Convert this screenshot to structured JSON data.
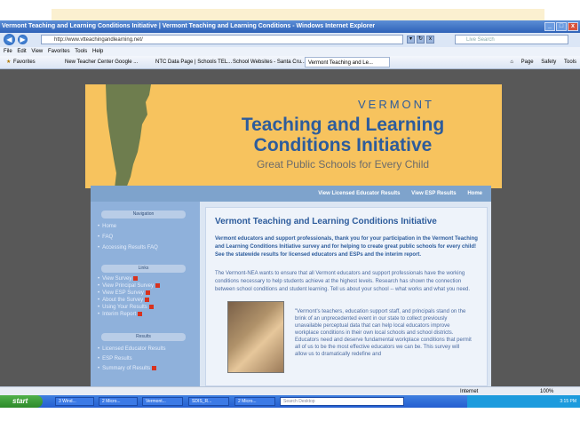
{
  "window": {
    "title": "Vermont Teaching and Learning Conditions Initiative | Vermont Teaching and Learning Conditions - Windows Internet Explorer"
  },
  "address_bar": {
    "url": "http://www.vtteachingandlearning.net/",
    "search_placeholder": "Live Search"
  },
  "menu": [
    "File",
    "Edit",
    "View",
    "Favorites",
    "Tools",
    "Help"
  ],
  "favorites": {
    "label": "Favorites",
    "items": [
      "New Teacher Center Google ...",
      "NTC Data Page | Schools TEL...",
      "School Websites - Santa Cru...",
      "Vermont Teaching and Le..."
    ],
    "commands": [
      "Page",
      "Safety",
      "Tools"
    ]
  },
  "banner": {
    "line1": "VERMONT",
    "line2": "Teaching and Learning",
    "line3": "Conditions Initiative",
    "line4": "Great Public Schools for Every Child",
    "colors": {
      "background": "#f7c35e",
      "title": "#2d5c9c",
      "map": "#6e7d4e"
    }
  },
  "site_nav": [
    "View Licensed Educator Results",
    "View ESP Results",
    "Home"
  ],
  "sidebar": {
    "navigation_heading": "Navigation",
    "navigation_items": [
      "Home",
      "FAQ",
      "Accessing Results FAQ"
    ],
    "links_heading": "Links",
    "link_items": [
      "View Survey",
      "View Principal Survey",
      "View ESP Survey",
      "About the Survey",
      "Using Your Results",
      "Interim Report"
    ],
    "results_heading": "Results",
    "result_items": [
      "Licensed Educator Results",
      "ESP Results",
      "Summary of Results"
    ]
  },
  "main": {
    "title": "Vermont Teaching and Learning Conditions Initiative",
    "intro": "Vermont educators and support professionals, thank you for your participation in the Vermont Teaching and Learning Conditions Initiative survey and for helping to create great public schools for every child! See the statewide results for licensed educators and ESPs and the interim report.",
    "paragraph": "The Vermont-NEA wants to ensure that all Vermont educators and support professionals have the working conditions necessary to help students achieve at the highest levels. Research has shown the connection between school conditions and student learning. Tell us about your school -- what works and what you need.",
    "quote": "\"Vermont's teachers, education support staff, and principals stand on the brink of an unprecedented event in our state to collect previously unavailable perceptual data that can help local educators improve workplace conditions in their own local schools and school districts. Educators need and deserve fundamental workplace conditions that permit all of us to be the most effective educators we can be. This survey will allow us to dramatically redefine and"
  },
  "status": {
    "zone": "Internet",
    "zoom": "100%"
  },
  "taskbar": {
    "start": "start",
    "items": [
      "3 Wind...",
      "2 Micro...",
      "Vermont...",
      "SDIS_R...",
      "2 Micro..."
    ],
    "search": "Search Desktop",
    "clock": "3:15 PM"
  }
}
